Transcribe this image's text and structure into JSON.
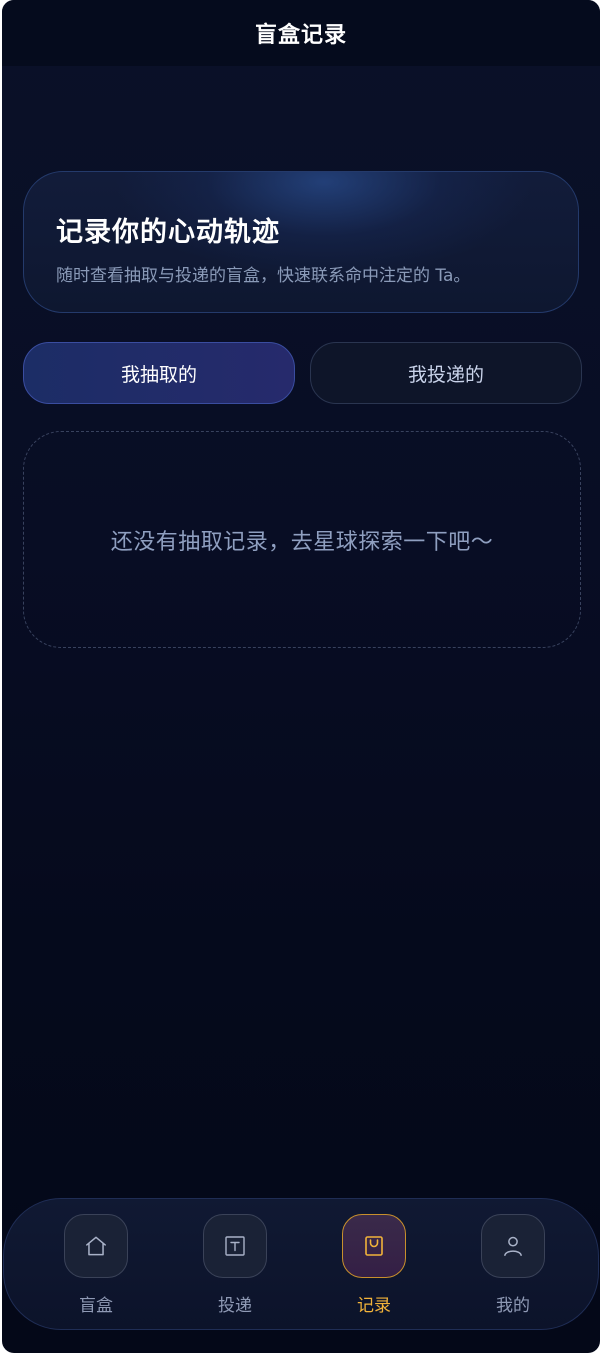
{
  "header": {
    "title": "盲盒记录"
  },
  "hero": {
    "title": "记录你的心动轨迹",
    "subtitle": "随时查看抽取与投递的盲盒，快速联系命中注定的 Ta。"
  },
  "tabs": [
    {
      "label": "我抽取的",
      "active": true
    },
    {
      "label": "我投递的",
      "active": false
    }
  ],
  "empty_state": {
    "message": "还没有抽取记录，去星球探索一下吧～"
  },
  "bottom_nav": {
    "items": [
      {
        "label": "盲盒",
        "icon": "home-icon",
        "active": false
      },
      {
        "label": "投递",
        "icon": "text-box-icon",
        "active": false
      },
      {
        "label": "记录",
        "icon": "bag-icon",
        "active": true
      },
      {
        "label": "我的",
        "icon": "user-icon",
        "active": false
      }
    ]
  },
  "colors": {
    "accent_active": "#f2b33a",
    "background": "#050a1c"
  }
}
